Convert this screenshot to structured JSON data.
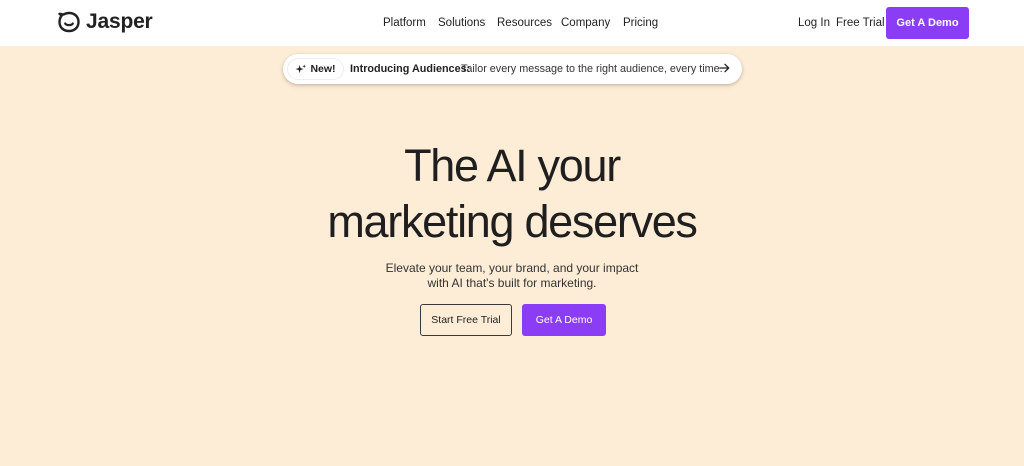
{
  "brand": {
    "name": "Jasper",
    "logo_icon": "jasper-face-icon"
  },
  "nav": {
    "menu": [
      "Platform",
      "Solutions",
      "Resources",
      "Company",
      "Pricing"
    ],
    "login": "Log In",
    "free_trial": "Free Trial",
    "demo": "Get A Demo"
  },
  "announcement": {
    "badge": "New!",
    "badge_icon": "sparkle-icon",
    "title": "Introducing Audiences:",
    "text": "Tailor every message to the right audience, every time.",
    "arrow_icon": "arrow-right-icon"
  },
  "hero": {
    "title_line1": "The AI your",
    "title_line2": "marketing deserves",
    "subtitle_line1": "Elevate your team, your brand, and your impact",
    "subtitle_line2": "with AI that's built for marketing.",
    "cta_primary": "Start Free Trial",
    "cta_secondary": "Get A Demo"
  },
  "colors": {
    "accent": "#8b3df5",
    "background": "#fdecd6",
    "nav_background": "#ffffff",
    "text": "#1f1f1f"
  }
}
